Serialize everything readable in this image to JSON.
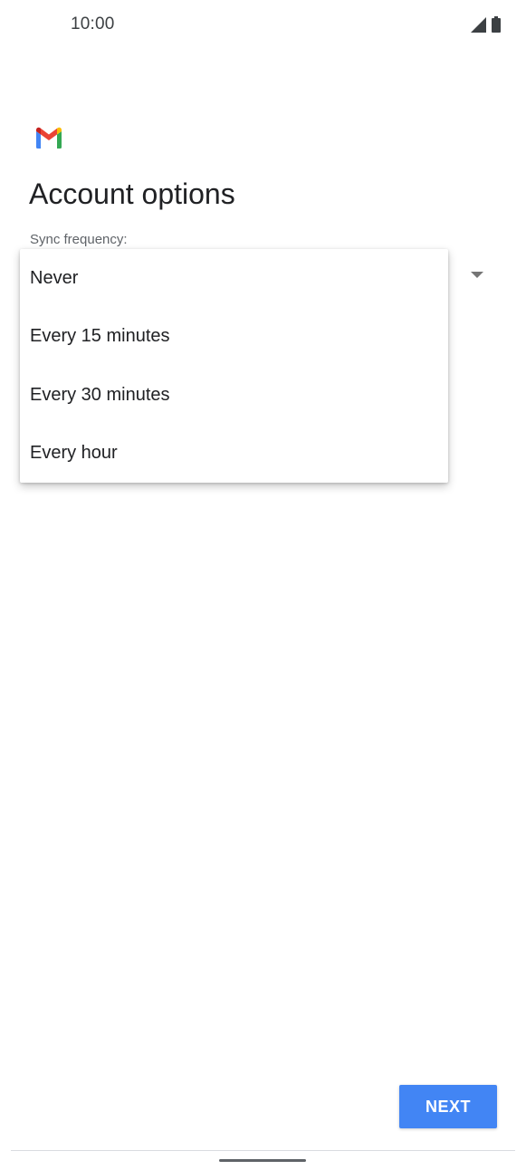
{
  "status_bar": {
    "time": "10:00",
    "icons": [
      "signal-icon",
      "battery-icon"
    ]
  },
  "app": {
    "logo": "gmail-logo"
  },
  "page": {
    "title": "Account options"
  },
  "sync_frequency": {
    "label": "Sync frequency:",
    "options": [
      {
        "label": "Never"
      },
      {
        "label": "Every 15 minutes"
      },
      {
        "label": "Every 30 minutes"
      },
      {
        "label": "Every hour"
      }
    ]
  },
  "actions": {
    "next_label": "NEXT"
  },
  "colors": {
    "accent": "#4285f4",
    "gmail_red": "#ea4335",
    "gmail_blue": "#4285f4",
    "gmail_green": "#34a853",
    "gmail_yellow": "#fbbc04",
    "text_primary": "#202124",
    "text_secondary": "#5f6368"
  }
}
